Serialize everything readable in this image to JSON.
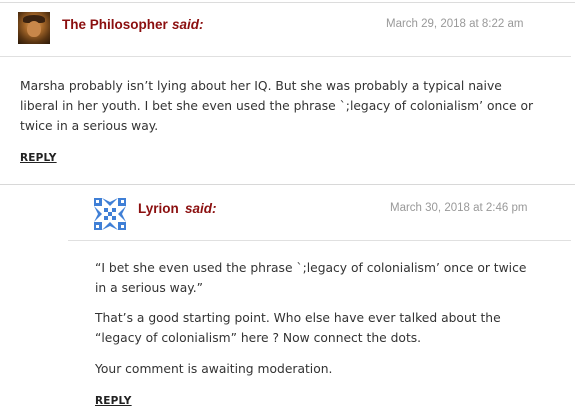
{
  "comments": [
    {
      "author": "The Philosopher",
      "said": "said:",
      "date": "March 29, 2018 at 8:22 am",
      "avatar": "portrait-avatar-icon",
      "paragraphs": [
        "Marsha probably isn’t lying about her IQ. But she was probably a typical naive",
        "liberal in her youth. I bet she even used the phrase `;legacy of colonialism’ once or",
        "twice in a serious way."
      ],
      "reply_label": "REPLY"
    },
    {
      "author": "Lyrion",
      "said": "said:",
      "date": "March 30, 2018 at 2:46 pm",
      "avatar": "identicon-avatar-icon",
      "paragraphs": [
        "“I bet she even used the phrase `;legacy of colonialism’ once or twice",
        "in a serious way.”",
        "That’s a good starting point. Who else have ever talked about the",
        "“legacy of colonialism” here ? Now connect the dots.",
        "Your comment is awaiting moderation."
      ],
      "reply_label": "REPLY"
    }
  ],
  "colors": {
    "author": "#8b0f0f",
    "date": "#999999",
    "text": "#333333",
    "identicon": "#3f7fd6"
  }
}
